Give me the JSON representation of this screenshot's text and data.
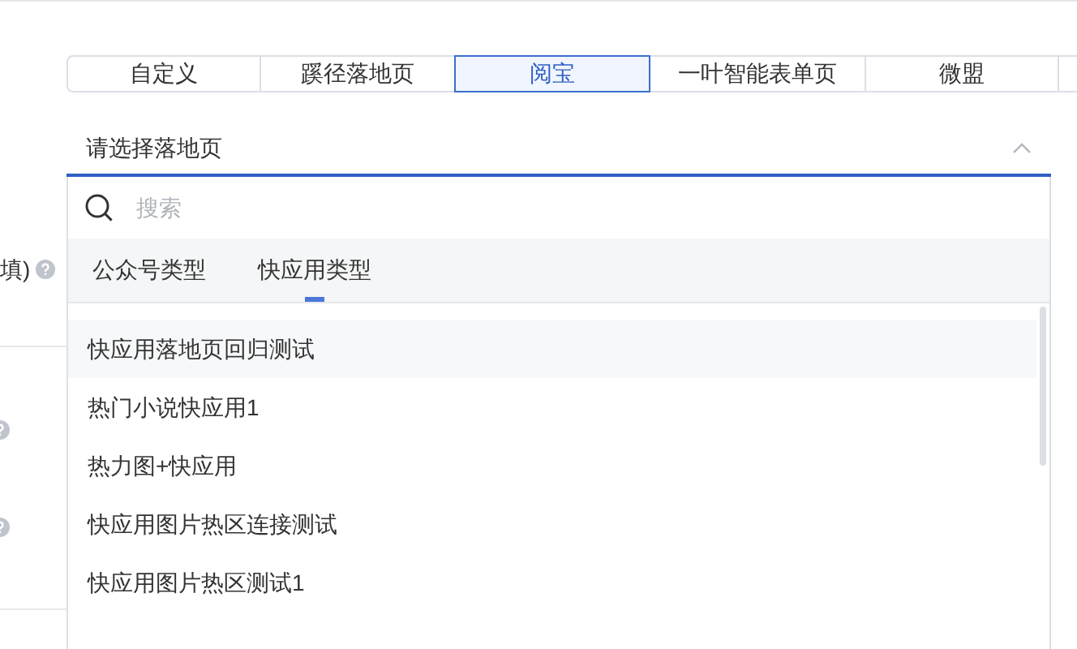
{
  "form": {
    "label": "填)"
  },
  "tabs": [
    {
      "label": "自定义",
      "selected": false
    },
    {
      "label": "蹊径落地页",
      "selected": false
    },
    {
      "label": "阅宝",
      "selected": true
    },
    {
      "label": "一叶智能表单页",
      "selected": false
    },
    {
      "label": "微盟",
      "selected": false
    }
  ],
  "select": {
    "placeholder": "请选择落地页",
    "expanded": true
  },
  "dropdown": {
    "search": {
      "placeholder": "搜索"
    },
    "type_tabs": [
      {
        "label": "公众号类型",
        "selected": false
      },
      {
        "label": "快应用类型",
        "selected": true
      }
    ],
    "items": [
      {
        "label": "快应用落地页回归测试",
        "hovered": true
      },
      {
        "label": "热门小说快应用1",
        "hovered": false
      },
      {
        "label": "热力图+快应用",
        "hovered": false
      },
      {
        "label": "快应用图片热区连接测试",
        "hovered": false
      },
      {
        "label": "快应用图片热区测试1",
        "hovered": false
      }
    ]
  }
}
